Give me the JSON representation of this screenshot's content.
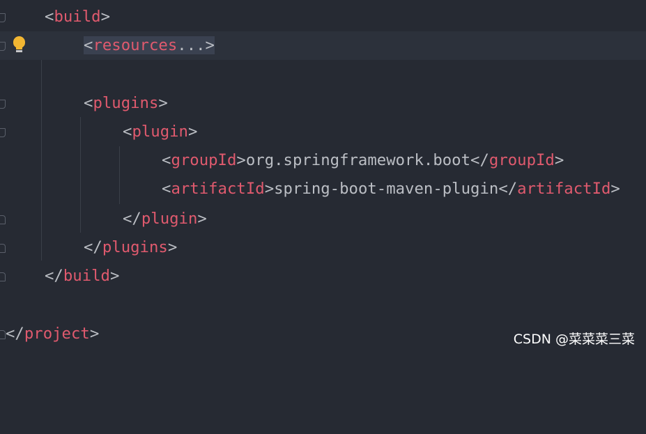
{
  "editor": {
    "lines": [
      {
        "open": "<",
        "tag": "build",
        "close": ">"
      },
      {
        "open": "<",
        "tag": "resources",
        "ellipsis": "...",
        "close": ">"
      },
      {
        "open": "<",
        "tag": "plugins",
        "close": ">"
      },
      {
        "open": "<",
        "tag": "plugin",
        "close": ">"
      },
      {
        "open": "<",
        "tag": "groupId",
        "mid": ">",
        "text": "org.springframework.boot",
        "open2": "</",
        "tag2": "groupId",
        "close": ">"
      },
      {
        "open": "<",
        "tag": "artifactId",
        "mid": ">",
        "text": "spring-boot-maven-plugin",
        "open2": "</",
        "tag2": "artifactId",
        "close": ">"
      },
      {
        "open": "</",
        "tag": "plugin",
        "close": ">"
      },
      {
        "open": "</",
        "tag": "plugins",
        "close": ">"
      },
      {
        "open": "</",
        "tag": "build",
        "close": ">"
      },
      {
        "open": "</",
        "tag": "project",
        "close": ">"
      }
    ]
  },
  "gutter": {
    "intention_icon": "lightbulb-icon"
  },
  "watermark": "CSDN @菜菜菜三菜",
  "colors": {
    "background": "#262a33",
    "current_line": "#2c313b",
    "tag": "#e05a6e",
    "text": "#bbbec4",
    "bulb": "#f2b632"
  }
}
